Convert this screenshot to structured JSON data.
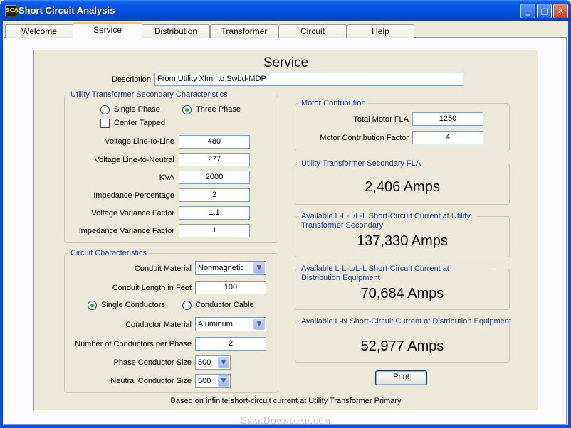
{
  "window": {
    "title": "Short Circuit Analysis",
    "icon": "app-icon",
    "icon_text": "SCA",
    "controls": {
      "minimize": "_",
      "maximize": "□",
      "close": "✕"
    }
  },
  "tabs": [
    {
      "label": "Welcome",
      "active": false
    },
    {
      "label": "Service",
      "active": true
    },
    {
      "label": "Distribution",
      "active": false
    },
    {
      "label": "Transformer",
      "active": false
    },
    {
      "label": "Circuit",
      "active": false
    },
    {
      "label": "Help",
      "active": false
    }
  ],
  "page": {
    "heading": "Service",
    "description_label": "Description",
    "description_value": "From Utility Xfmr to Swbd-MDP"
  },
  "utility_group": {
    "title": "Utility Transformer Secondary Characteristics",
    "single_phase_label": "Single Phase",
    "three_phase_label": "Three Phase",
    "phase_selected": "Three Phase",
    "center_tapped_label": "Center Tapped",
    "center_tapped_checked": false,
    "fields": [
      {
        "label": "Voltage Line-to-Line",
        "value": "480"
      },
      {
        "label": "Voltage Line-to-Neutral",
        "value": "277"
      },
      {
        "label": "KVA",
        "value": "2000"
      },
      {
        "label": "Impedance Percentage",
        "value": "2"
      },
      {
        "label": "Voltage Variance Factor",
        "value": "1.1"
      },
      {
        "label": "Impedance Variance Factor",
        "value": "1"
      }
    ]
  },
  "circuit_group": {
    "title": "Circuit Characteristics",
    "conduit_material_label": "Conduit Material",
    "conduit_material_value": "Nonmagnetic",
    "conduit_length_label": "Conduit Length in Feet",
    "conduit_length_value": "100",
    "single_conductors_label": "Single Conductors",
    "conductor_cable_label": "Conductor Cable",
    "conductor_type_selected": "Single Conductors",
    "conductor_material_label": "Conductor Material",
    "conductor_material_value": "Aluminum",
    "conductors_per_phase_label": "Number of Conductors per Phase",
    "conductors_per_phase_value": "2",
    "phase_conductor_size_label": "Phase Conductor Size",
    "phase_conductor_size_value": "500",
    "neutral_conductor_size_label": "Neutral Conductor Size",
    "neutral_conductor_size_value": "500"
  },
  "motor_group": {
    "title": "Motor Contribution",
    "total_fla_label": "Total Motor FLA",
    "total_fla_value": "1250",
    "factor_label": "Motor Contribution Factor",
    "factor_value": "4"
  },
  "results": [
    {
      "title": "Utility Transformer Secondary FLA",
      "value": "2,406 Amps"
    },
    {
      "title": "Available  L-L-L/L-L Short-Circuit Current at Utility Transformer Secondary",
      "value": "137,330 Amps"
    },
    {
      "title": "Available  L-L-L/L-L Short-Circuit Current at Distribution Equipment",
      "value": "70,684 Amps"
    },
    {
      "title": "Available L-N Short-Circuit Current at Distribution Equipment",
      "value": "52,977 Amps"
    }
  ],
  "print_label": "Print",
  "footer_note": "Based on infinite short-circuit current at Utility Transformer Primary",
  "watermark": "GearDownload.com",
  "colors": {
    "titlebar": "#0550DC",
    "group_title": "#1F3E9C",
    "window_bg": "#ECE9D8",
    "active_tab_accent": "#FFC83C"
  }
}
